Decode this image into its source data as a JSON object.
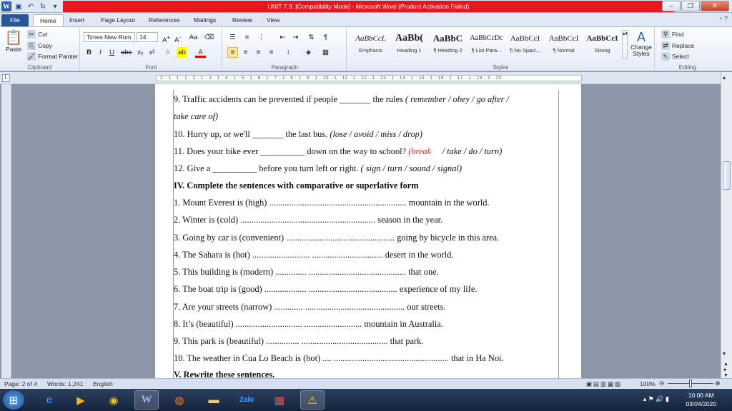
{
  "window": {
    "title": "UNIT 7.3. [Compatibility Mode] - Microsoft Word (Product Activation Failed)",
    "controls": [
      "–",
      "❐",
      "✕"
    ]
  },
  "tabs": [
    "File",
    "Home",
    "Insert",
    "Page Layout",
    "References",
    "Mailings",
    "Review",
    "View"
  ],
  "ribbon": {
    "clipboard": {
      "paste": "Paste",
      "cut": "Cut",
      "copy": "Copy",
      "format_painter": "Format Painter",
      "label": "Clipboard"
    },
    "font": {
      "family": "Times New Rom",
      "size": "14",
      "label": "Font"
    },
    "paragraph": {
      "label": "Paragraph"
    },
    "styles": {
      "label": "Styles",
      "items": [
        {
          "preview": "AaBbCcL",
          "name": "Emphasis"
        },
        {
          "preview": "AaBb(",
          "name": "Heading 1"
        },
        {
          "preview": "AaBbC",
          "name": "¶ Heading 2"
        },
        {
          "preview": "AaBbCcDc",
          "name": "¶ List Para..."
        },
        {
          "preview": "AaBbCcI",
          "name": "¶ No Spaci..."
        },
        {
          "preview": "AaBbCcI",
          "name": "¶ Normal"
        },
        {
          "preview": "AaBbCcI",
          "name": "Strong"
        }
      ],
      "change_styles": "Change Styles"
    },
    "editing": {
      "find": "Find",
      "replace": "Replace",
      "select": "Select",
      "label": "Editing"
    }
  },
  "ruler": "· 2 · 1 · 1 · 1 · 2 · 1 · 3 · 1 · 4 · 1 · 5 · 1 · 6 · 1 · 7 · 1 · 8 · 1 · 9 · 1 · 10 · 1 · 11 · 1 · 12 · 1 · 13 · 1 · 14 · 1 · 15 · 1 · 16 · 1 · 17 · 1 · 18 · 1 · 20",
  "document": {
    "l9a_text": "9. Traffic accidents can be prevented if people _______ the rules ",
    "l9a_opt": "( remember / obey / go after /",
    "l9b_opt": "take care of)",
    "l10_text": "10. Hurry up, or we'll _______ the last bus. ",
    "l10_opt": "(lose / avoid / miss / drop)",
    "l11_text": "11. Does your bike ever __________ down on the way to school? ",
    "l11_red": "(break",
    "l11_opt": "/ take / do / turn)",
    "l12_text": "12. Give a __________ before you turn left or right. ",
    "l12_opt": "( sign / turn / sound / signal)",
    "heading4": "IV. Complete the sentences with comparative or superlative form",
    "s1": "1. Mount Everest is (high) .............................................................. mountain in the world.",
    "s2": "2. Winter is (cold) ............................................................. season in the year.",
    "s3": "3. Going by car is (convenient) ................................................. going by bicycle in this area.",
    "s4": "4. The Sahara is (hot) .......................... ................................ desert in the world.",
    "s5": "5. This building is (modern) .............. ............................................ that one.",
    "s6": "6. The boat trip is (good) ................... ........................................ experience of my life.",
    "s7": "7. Are your streets (narrow) ............. ............................................. our streets.",
    "s8": "8. It’s (beautiful) .............................. .......................... mountain in Australia.",
    "s9": "9. This park is (beautiful) ............... ....................................... that park.",
    "s10": "10. The weather in Cua Lo Beach is (hot) .... .................................................... that in Ha Noi.",
    "heading5": "V. Rewrite these sentences."
  },
  "status": {
    "page": "Page: 2 of 4",
    "words": "Words: 1,241",
    "language": "English",
    "zoom": "100%"
  },
  "taskbar": {
    "time": "10:00 AM",
    "date": "03/04/2020"
  }
}
